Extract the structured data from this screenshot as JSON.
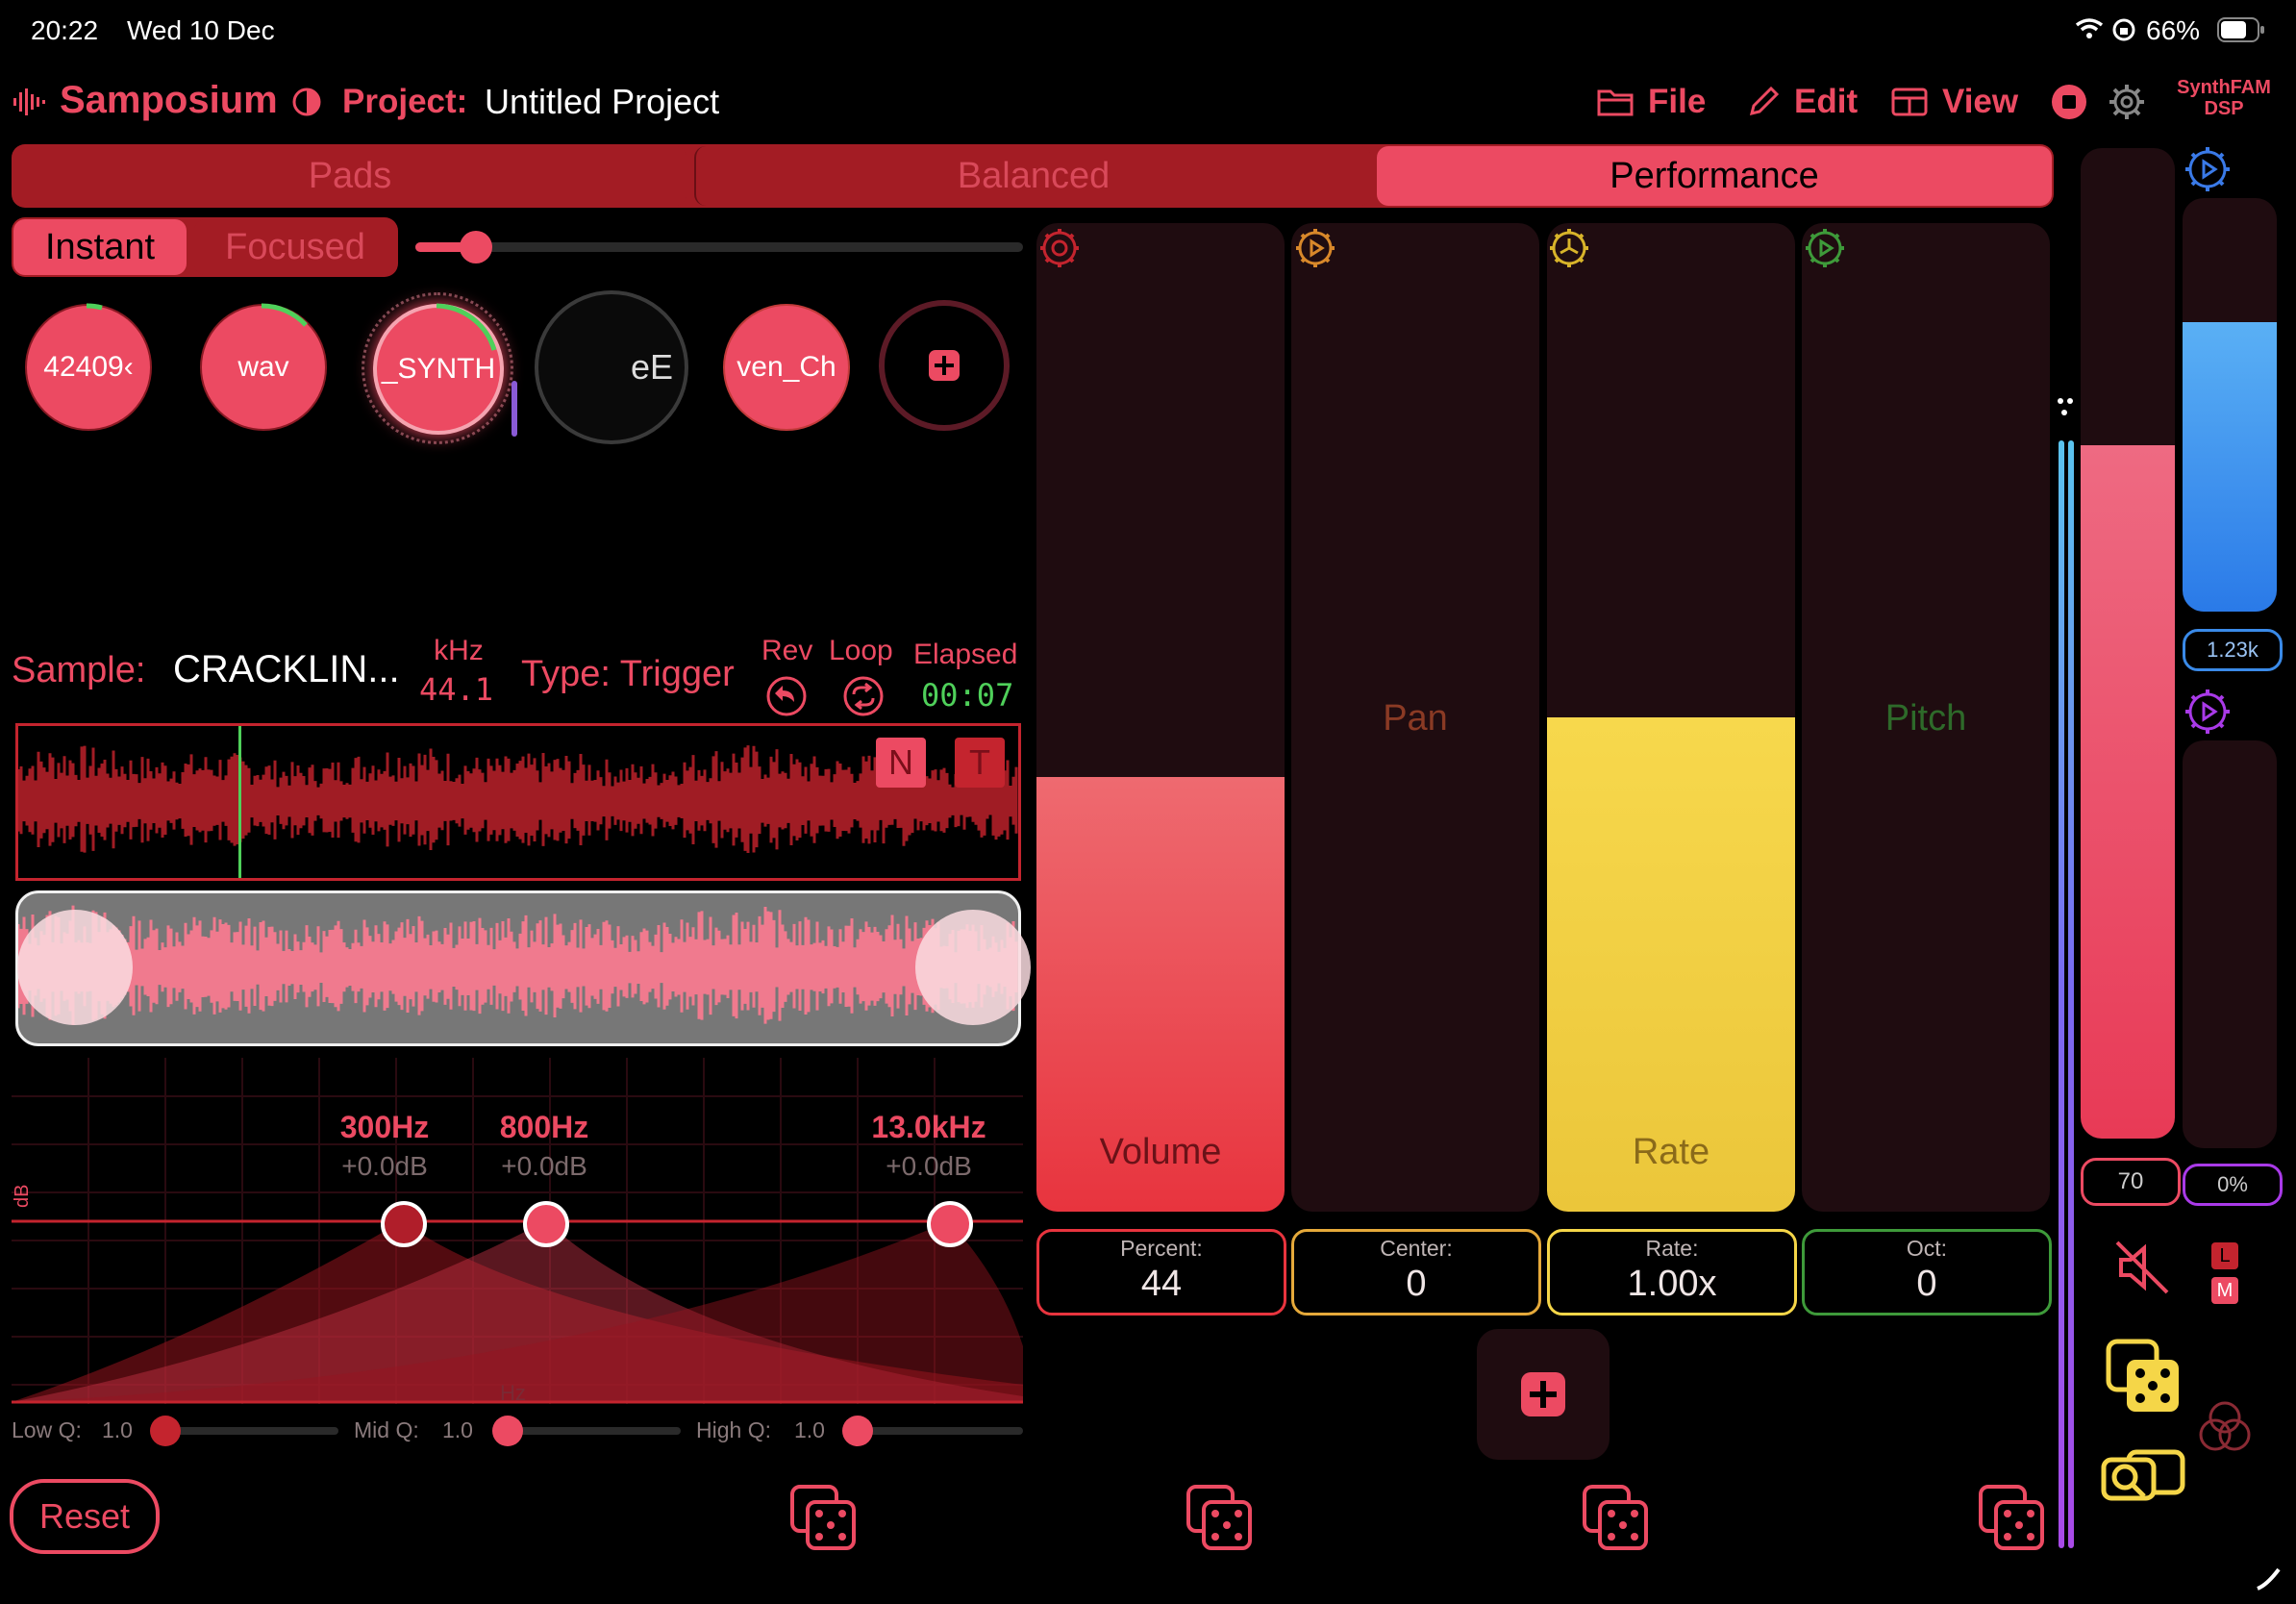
{
  "status": {
    "time": "20:22",
    "date": "Wed 10 Dec",
    "battery": "66%"
  },
  "header": {
    "app_name": "Samposium",
    "project_label": "Project:",
    "project_name": "Untitled Project",
    "menu": {
      "file": "File",
      "edit": "Edit",
      "view": "View"
    },
    "brand_line1": "SynthFAM",
    "brand_line2": "DSP"
  },
  "tabs": [
    {
      "label": "Pads",
      "selected": false
    },
    {
      "label": "Balanced",
      "selected": false
    },
    {
      "label": "Performance",
      "selected": true
    }
  ],
  "mode": {
    "instant": "Instant",
    "focused": "Focused",
    "selected": "Instant",
    "slider_value": 0.1
  },
  "pads": [
    {
      "label": "42409‹"
    },
    {
      "label": "wav"
    },
    {
      "label": "_SYNTH"
    },
    {
      "label": "eE"
    },
    {
      "label": "ven_Ch"
    }
  ],
  "sample": {
    "label": "Sample:",
    "name": "CRACKLIN...",
    "khz_label": "kHz",
    "khz_value": "44.1",
    "type": "Type: Trigger",
    "rev": "Rev",
    "loop": "Loop",
    "elapsed_label": "Elapsed",
    "elapsed_value": "00:07",
    "n_button": "N",
    "t_button": "T",
    "playhead_fraction": 0.22
  },
  "eq": {
    "bands": [
      {
        "freq": "300Hz",
        "gain": "+0.0dB"
      },
      {
        "freq": "800Hz",
        "gain": "+0.0dB"
      },
      {
        "freq": "13.0kHz",
        "gain": "+0.0dB"
      }
    ],
    "y_axis": "dB",
    "x_axis": "Hz",
    "low_q_label": "Low Q:",
    "low_q_value": "1.0",
    "mid_q_label": "Mid Q:",
    "mid_q_value": "1.0",
    "high_q_label": "High Q:",
    "high_q_value": "1.0"
  },
  "reset_label": "Reset",
  "controls": [
    {
      "name": "Volume",
      "key": "Percent:",
      "value": "44",
      "level": 0.44,
      "color": "#ec4a62"
    },
    {
      "name": "Pan",
      "key": "Center:",
      "value": "0",
      "level": 0.0,
      "color": "#e5a93a"
    },
    {
      "name": "Rate",
      "key": "Rate:",
      "value": "1.00x",
      "level": 0.5,
      "color": "#f5d648"
    },
    {
      "name": "Pitch",
      "key": "Oct:",
      "value": "0",
      "level": 0.0,
      "color": "#3e9a3a"
    }
  ],
  "side": {
    "pink_value": "70",
    "pink_level": 0.7,
    "blue_value": "1.23k",
    "blue_level": 0.7,
    "purple_value": "0%",
    "purple_level": 0.0,
    "l_label": "L",
    "m_label": "M"
  }
}
